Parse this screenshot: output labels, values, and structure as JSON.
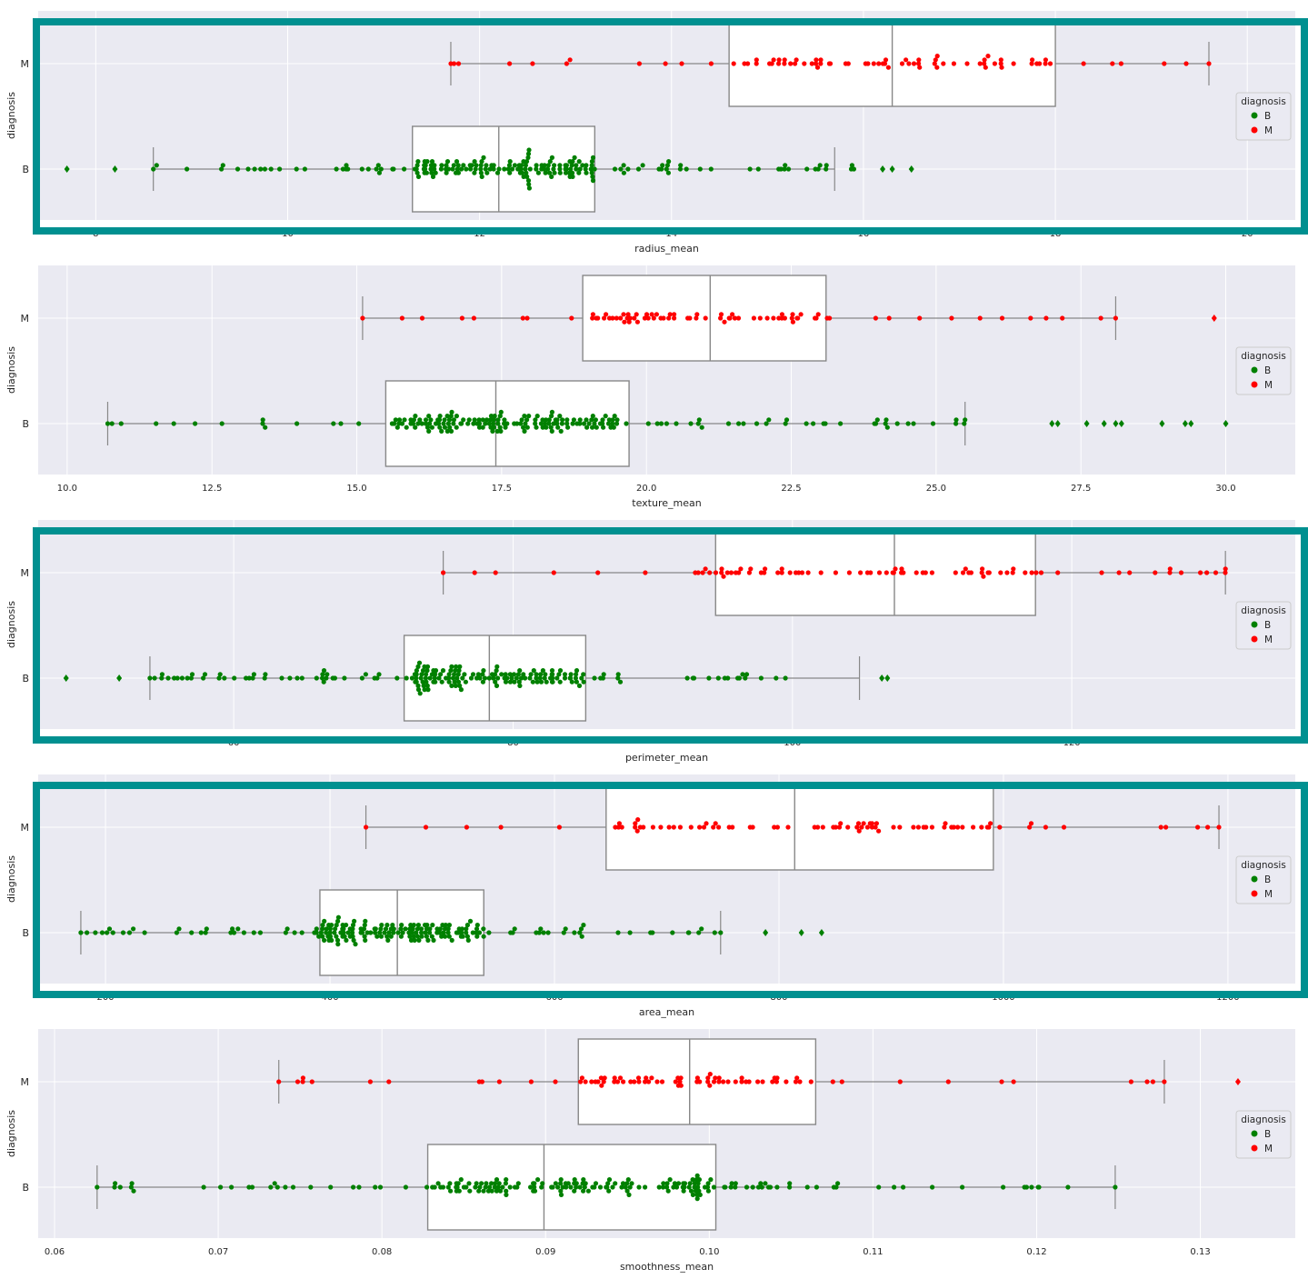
{
  "colors": {
    "plot_bg": "#eaeaf2",
    "grid": "#ffffff",
    "box_edge": "#888888",
    "box_fill": "#ffffff",
    "benign": "#008000",
    "malignant": "#ff0000",
    "highlight_frame": "#009090",
    "text": "#262626"
  },
  "chart_data": [
    {
      "type": "box+swarm",
      "orientation": "horizontal",
      "xlabel": "radius_mean",
      "ylabel": "diagnosis",
      "categories": [
        "M",
        "B"
      ],
      "xlim": [
        7.4,
        20.5
      ],
      "xticks": [
        8,
        10,
        12,
        14,
        16,
        18,
        20
      ],
      "tick_labels": [
        "8",
        "10",
        "12",
        "14",
        "16",
        "18",
        "20"
      ],
      "highlighted": true,
      "legend": {
        "title": "diagnosis",
        "entries": [
          "B",
          "M"
        ],
        "placement": "right"
      },
      "boxes": [
        {
          "category": "M",
          "whisker_low": 11.7,
          "q1": 14.6,
          "median": 16.3,
          "q3": 18.0,
          "whisker_high": 19.6
        },
        {
          "category": "B",
          "whisker_low": 8.6,
          "q1": 11.3,
          "median": 12.2,
          "q3": 13.2,
          "whisker_high": 15.7
        }
      ],
      "points": [
        {
          "category": "M",
          "range": [
            11.7,
            19.6
          ],
          "n": 80,
          "cluster": [
            14.6,
            18.0
          ]
        },
        {
          "category": "B",
          "range": [
            8.6,
            15.9
          ],
          "n": 200,
          "cluster": [
            11.3,
            13.2
          ]
        }
      ],
      "outliers": [
        {
          "category": "B",
          "values": [
            7.7,
            8.2,
            16.2,
            16.3,
            16.5
          ]
        }
      ]
    },
    {
      "type": "box+swarm",
      "orientation": "horizontal",
      "xlabel": "texture_mean",
      "ylabel": "diagnosis",
      "categories": [
        "M",
        "B"
      ],
      "xlim": [
        9.5,
        31.2
      ],
      "xticks": [
        10.0,
        12.5,
        15.0,
        17.5,
        20.0,
        22.5,
        25.0,
        27.5,
        30.0
      ],
      "tick_labels": [
        "10.0",
        "12.5",
        "15.0",
        "17.5",
        "20.0",
        "22.5",
        "25.0",
        "27.5",
        "30.0"
      ],
      "highlighted": false,
      "legend": {
        "title": "diagnosis",
        "entries": [
          "B",
          "M"
        ],
        "placement": "right"
      },
      "boxes": [
        {
          "category": "M",
          "whisker_low": 15.1,
          "q1": 18.9,
          "median": 21.1,
          "q3": 23.1,
          "whisker_high": 28.1
        },
        {
          "category": "B",
          "whisker_low": 10.7,
          "q1": 15.5,
          "median": 17.4,
          "q3": 19.7,
          "whisker_high": 25.5
        }
      ],
      "points": [
        {
          "category": "M",
          "range": [
            15.1,
            28.1
          ],
          "n": 80,
          "cluster": [
            18.9,
            23.1
          ]
        },
        {
          "category": "B",
          "range": [
            10.7,
            25.5
          ],
          "n": 200,
          "cluster": [
            15.5,
            19.7
          ]
        }
      ],
      "outliers": [
        {
          "category": "M",
          "values": [
            29.8
          ]
        },
        {
          "category": "B",
          "values": [
            27.0,
            27.1,
            27.6,
            27.9,
            28.1,
            28.2,
            28.9,
            29.3,
            29.4,
            30.0
          ]
        }
      ]
    },
    {
      "type": "box+swarm",
      "orientation": "horizontal",
      "xlabel": "perimeter_mean",
      "ylabel": "diagnosis",
      "categories": [
        "M",
        "B"
      ],
      "xlim": [
        46,
        136
      ],
      "xticks": [
        60,
        80,
        100,
        120
      ],
      "tick_labels": [
        "60",
        "80",
        "100",
        "120"
      ],
      "highlighted": true,
      "legend": {
        "title": "diagnosis",
        "entries": [
          "B",
          "M"
        ],
        "placement": "right"
      },
      "boxes": [
        {
          "category": "M",
          "whisker_low": 75,
          "q1": 94.5,
          "median": 107.3,
          "q3": 117.4,
          "whisker_high": 131
        },
        {
          "category": "B",
          "whisker_low": 54,
          "q1": 72.2,
          "median": 78.3,
          "q3": 85.2,
          "whisker_high": 104.8
        }
      ],
      "points": [
        {
          "category": "M",
          "range": [
            75,
            131
          ],
          "n": 80,
          "cluster": [
            94.5,
            117.4
          ]
        },
        {
          "category": "B",
          "range": [
            54,
            99.5
          ],
          "n": 200,
          "cluster": [
            72.2,
            85.2
          ]
        }
      ],
      "outliers": [
        {
          "category": "B",
          "values": [
            48.0,
            51.8,
            106.4,
            106.8
          ]
        }
      ]
    },
    {
      "type": "box+swarm",
      "orientation": "horizontal",
      "xlabel": "area_mean",
      "ylabel": "diagnosis",
      "categories": [
        "M",
        "B"
      ],
      "xlim": [
        140,
        1260
      ],
      "xticks": [
        200,
        400,
        600,
        800,
        1000,
        1200
      ],
      "tick_labels": [
        "200",
        "400",
        "600",
        "800",
        "1000",
        "1200"
      ],
      "highlighted": true,
      "legend": {
        "title": "diagnosis",
        "entries": [
          "B",
          "M"
        ],
        "placement": "right"
      },
      "boxes": [
        {
          "category": "M",
          "whisker_low": 432,
          "q1": 646,
          "median": 814,
          "q3": 991,
          "whisker_high": 1192
        },
        {
          "category": "B",
          "whisker_low": 178,
          "q1": 391,
          "median": 460,
          "q3": 537,
          "whisker_high": 748
        }
      ],
      "points": [
        {
          "category": "M",
          "range": [
            432,
            1192
          ],
          "n": 80,
          "cluster": [
            646,
            991
          ]
        },
        {
          "category": "B",
          "range": [
            178,
            748
          ],
          "n": 200,
          "cluster": [
            391,
            537
          ]
        }
      ],
      "outliers": [
        {
          "category": "B",
          "values": [
            788,
            820,
            838
          ]
        }
      ]
    },
    {
      "type": "box+swarm",
      "orientation": "horizontal",
      "xlabel": "smoothness_mean",
      "ylabel": "diagnosis",
      "categories": [
        "M",
        "B"
      ],
      "xlim": [
        0.059,
        0.1358
      ],
      "xticks": [
        0.06,
        0.07,
        0.08,
        0.09,
        0.1,
        0.11,
        0.12,
        0.13
      ],
      "tick_labels": [
        "0.06",
        "0.07",
        "0.08",
        "0.09",
        "0.10",
        "0.11",
        "0.12",
        "0.13"
      ],
      "highlighted": false,
      "legend": {
        "title": "diagnosis",
        "entries": [
          "B",
          "M"
        ],
        "placement": "right"
      },
      "boxes": [
        {
          "category": "M",
          "whisker_low": 0.0737,
          "q1": 0.092,
          "median": 0.0988,
          "q3": 0.1065,
          "whisker_high": 0.1278
        },
        {
          "category": "B",
          "whisker_low": 0.0626,
          "q1": 0.0828,
          "median": 0.0899,
          "q3": 0.1004,
          "whisker_high": 0.1248
        }
      ],
      "points": [
        {
          "category": "M",
          "range": [
            0.0737,
            0.1278
          ],
          "n": 80,
          "cluster": [
            0.092,
            0.1065
          ]
        },
        {
          "category": "B",
          "range": [
            0.0626,
            0.1248
          ],
          "n": 200,
          "cluster": [
            0.0828,
            0.1004
          ]
        }
      ],
      "outliers": [
        {
          "category": "M",
          "values": [
            0.1323
          ]
        }
      ]
    }
  ]
}
